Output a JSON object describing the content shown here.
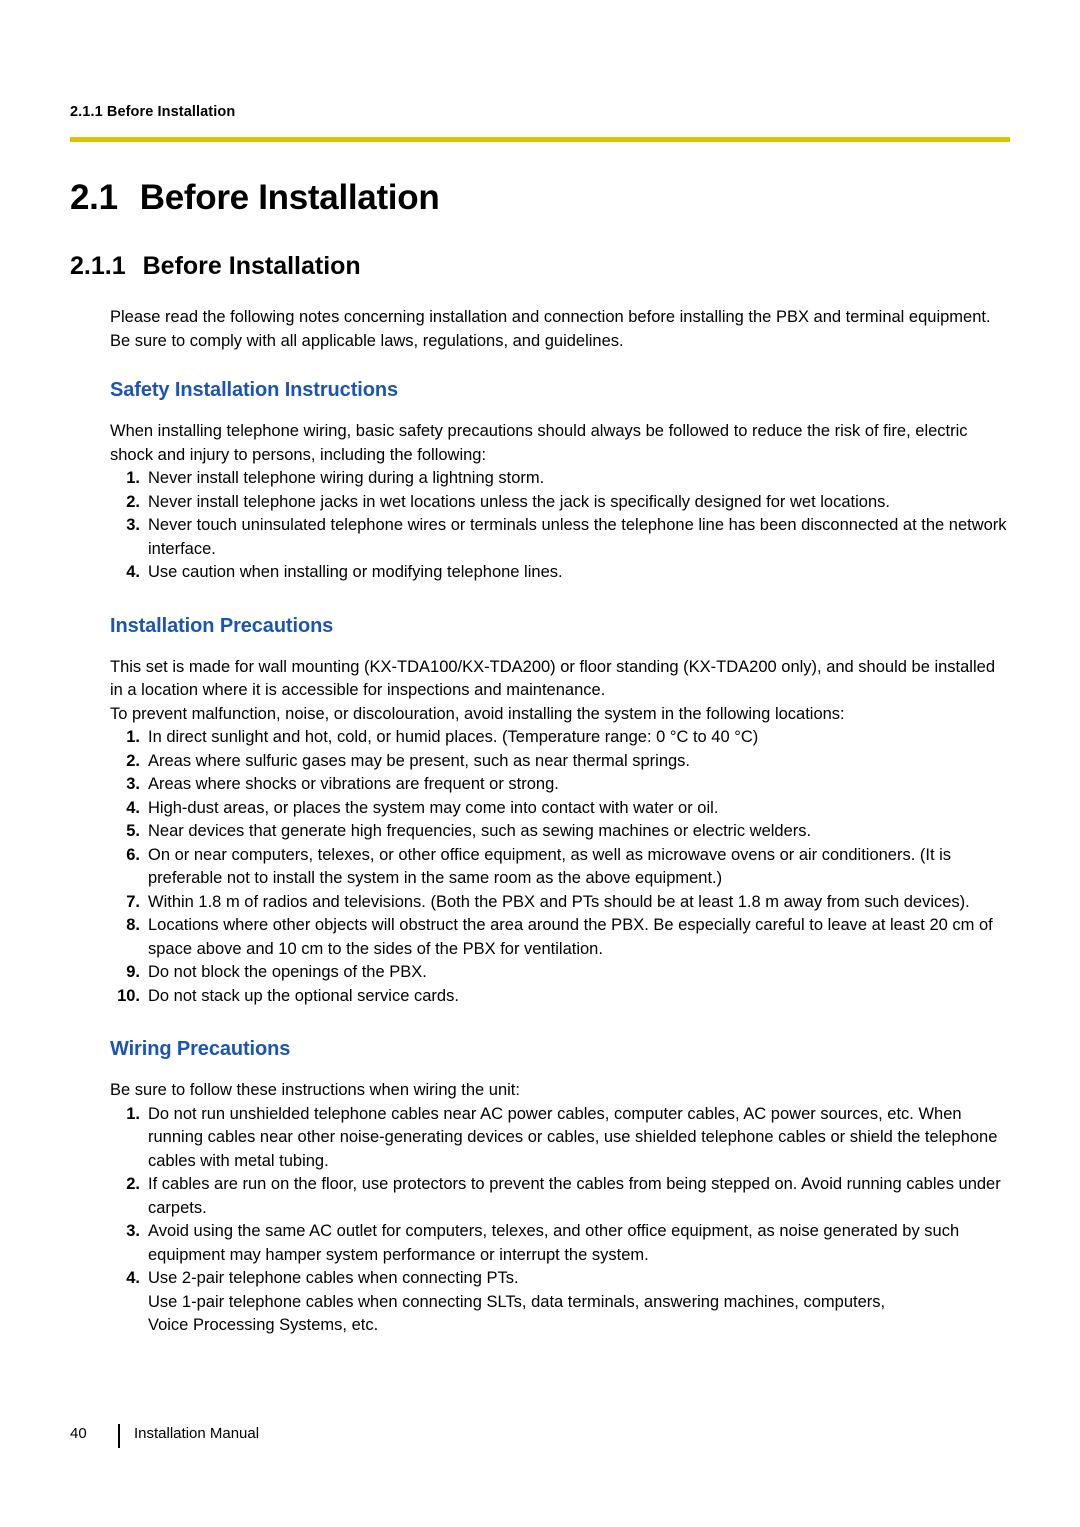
{
  "header": {
    "breadcrumb": "2.1.1  Before Installation",
    "rule_color": "#d9c400"
  },
  "headings": {
    "h1_number": "2.1",
    "h1_title": "Before Installation",
    "h2_number": "2.1.1",
    "h2_title": "Before Installation",
    "accent_color": "#1b55b4"
  },
  "intro": {
    "paragraph1": "Please read the following notes concerning installation and connection before installing the PBX and terminal equipment.",
    "paragraph2": "Be sure to comply with all applicable laws, regulations, and guidelines."
  },
  "safety": {
    "title": "Safety Installation Instructions",
    "intro": "When installing telephone wiring, basic safety precautions should always be followed to reduce the risk of fire, electric shock and injury to persons, including the following:",
    "items": [
      {
        "num": "1.",
        "text": "Never install telephone wiring during a lightning storm."
      },
      {
        "num": "2.",
        "text": "Never install telephone jacks in wet locations unless the jack is specifically designed for wet locations."
      },
      {
        "num": "3.",
        "text": "Never touch uninsulated telephone wires or terminals unless the telephone line has been disconnected at the network interface."
      },
      {
        "num": "4.",
        "text": "Use caution when installing or modifying telephone lines."
      }
    ]
  },
  "installation": {
    "title": "Installation Precautions",
    "intro1": "This set is made for wall mounting (KX-TDA100/KX-TDA200) or floor standing (KX-TDA200 only), and should be installed in a location where it is accessible for inspections and maintenance.",
    "intro2": "To prevent malfunction, noise, or discolouration, avoid installing the system in the following locations:",
    "items": [
      {
        "num": "1.",
        "text": "In direct sunlight and hot, cold, or humid places. (Temperature range: 0 °C to 40 °C)"
      },
      {
        "num": "2.",
        "text": "Areas where sulfuric gases may be present, such as near thermal springs."
      },
      {
        "num": "3.",
        "text": "Areas where shocks or vibrations are frequent or strong."
      },
      {
        "num": "4.",
        "text": "High-dust areas, or places the system may come into contact with water or oil."
      },
      {
        "num": "5.",
        "text": "Near devices that generate high frequencies, such as sewing machines or electric welders."
      },
      {
        "num": "6.",
        "text": "On or near computers, telexes, or other office equipment, as well as microwave ovens or air conditioners. (It is preferable not to install the system in the same room as the above equipment.)"
      },
      {
        "num": "7.",
        "text": "Within 1.8 m of radios and televisions. (Both the PBX and PTs should be at least 1.8 m away from such devices)."
      },
      {
        "num": "8.",
        "text": "Locations where other objects will obstruct the area around the PBX. Be especially careful to leave at least 20 cm of space above and 10 cm to the sides of the PBX for ventilation."
      },
      {
        "num": "9.",
        "text": "Do not block the openings of the PBX."
      },
      {
        "num": "10.",
        "text": "Do not stack up the optional service cards."
      }
    ]
  },
  "wiring": {
    "title": "Wiring Precautions",
    "intro": "Be sure to follow these instructions when wiring the unit:",
    "items": [
      {
        "num": "1.",
        "text": "Do not run unshielded telephone cables near AC power cables, computer cables, AC power sources, etc. When running cables near other noise-generating devices or cables, use shielded telephone cables or shield the telephone cables with metal tubing."
      },
      {
        "num": "2.",
        "text": "If cables are run on the floor, use protectors to prevent the cables from being stepped on. Avoid running cables under carpets."
      },
      {
        "num": "3.",
        "text": "Avoid using the same AC outlet for computers, telexes, and other office equipment, as noise generated by such equipment may hamper system performance or interrupt the system."
      },
      {
        "num": "4.",
        "text": "Use 2-pair telephone cables when connecting PTs."
      }
    ],
    "item4_extra_line1": "Use 1-pair telephone cables when connecting SLTs, data terminals, answering machines, computers,",
    "item4_extra_line2": "Voice Processing Systems, etc."
  },
  "footer": {
    "page_number": "40",
    "manual_title": "Installation Manual"
  }
}
